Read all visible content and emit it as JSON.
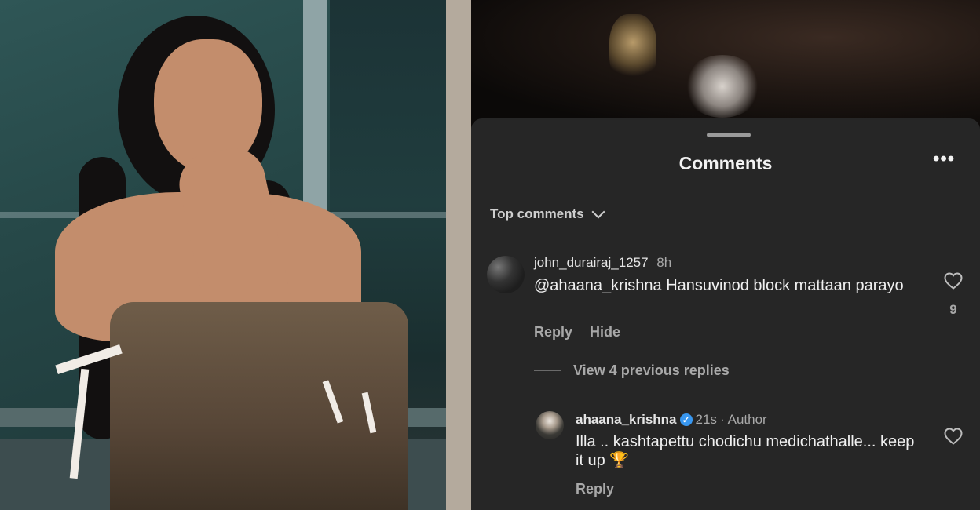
{
  "comments_sheet": {
    "title": "Comments",
    "more_label": "•••",
    "sort_label": "Top comments"
  },
  "comments": [
    {
      "username": "john_durairaj_1257",
      "time": "8h",
      "text": "@ahaana_krishna Hansuvinod block mattaan parayo",
      "reply_label": "Reply",
      "hide_label": "Hide",
      "likes": "9"
    }
  ],
  "view_replies_label": "View 4 previous replies",
  "reply": {
    "username": "ahaana_krishna",
    "verified_badge": "✓",
    "time": "21s",
    "separator": "·",
    "author_label": "Author",
    "text": "Illa .. kashtapettu chodichu medichathalle... keep it up 🏆",
    "reply_label": "Reply"
  },
  "colors": {
    "sheet_bg": "#262626",
    "verified": "#3897f0",
    "muted_text": "#a8a8a8"
  }
}
